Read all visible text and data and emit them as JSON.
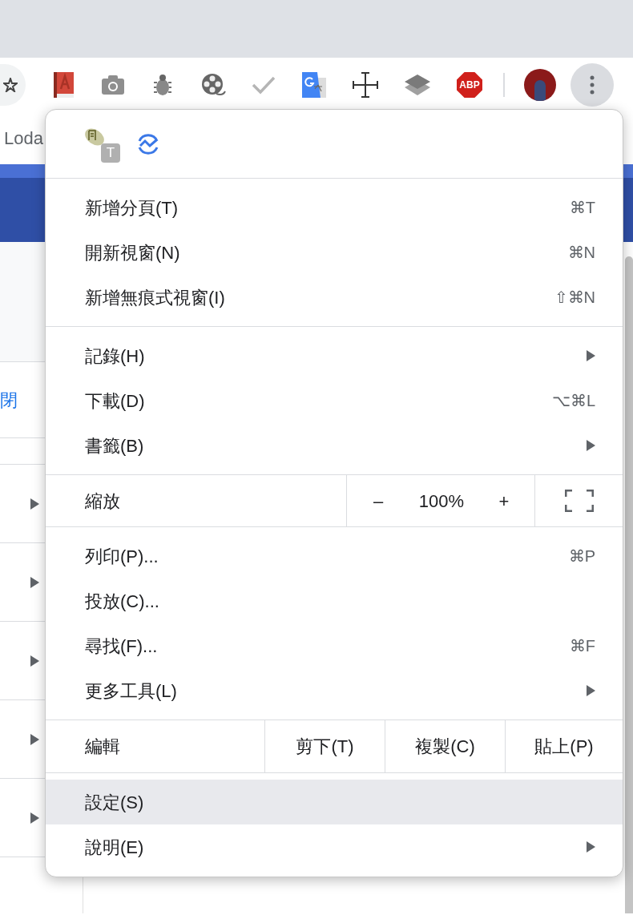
{
  "toolbar": {
    "extensions": [
      {
        "kind": "book"
      },
      {
        "kind": "camera"
      },
      {
        "kind": "bug"
      },
      {
        "kind": "film"
      },
      {
        "kind": "check"
      },
      {
        "kind": "translate"
      },
      {
        "kind": "crosshair"
      },
      {
        "kind": "layers"
      },
      {
        "kind": "abp",
        "label": "ABP"
      }
    ]
  },
  "bookmarks_bar": {
    "item": "Loda"
  },
  "page": {
    "link": "閉",
    "rows": [
      {
        "arrow": true
      },
      {
        "arrow": true
      },
      {
        "arrow": true
      },
      {
        "arrow": true
      },
      {
        "arrow": true
      }
    ]
  },
  "menu": {
    "header_icons": [
      {
        "kind": "dict",
        "badge": "T"
      },
      {
        "kind": "wave"
      }
    ],
    "sections": [
      {
        "kind": "items",
        "items": [
          {
            "label": "新增分頁(T)",
            "shortcut": "⌘T",
            "submenu": false,
            "highlighted": false
          },
          {
            "label": "開新視窗(N)",
            "shortcut": "⌘N",
            "submenu": false,
            "highlighted": false
          },
          {
            "label": "新增無痕式視窗(I)",
            "shortcut": "⇧⌘N",
            "submenu": false,
            "highlighted": false
          }
        ]
      },
      {
        "kind": "items",
        "items": [
          {
            "label": "記錄(H)",
            "submenu": true,
            "highlighted": false
          },
          {
            "label": "下載(D)",
            "shortcut": "⌥⌘L",
            "submenu": false,
            "highlighted": false
          },
          {
            "label": "書籤(B)",
            "submenu": true,
            "highlighted": false
          }
        ]
      },
      {
        "kind": "zoom",
        "label": "縮放",
        "minus": "–",
        "value": "100%",
        "plus": "+"
      },
      {
        "kind": "items",
        "items": [
          {
            "label": "列印(P)...",
            "shortcut": "⌘P",
            "submenu": false,
            "highlighted": false
          },
          {
            "label": "投放(C)...",
            "submenu": false,
            "highlighted": false
          },
          {
            "label": "尋找(F)...",
            "shortcut": "⌘F",
            "submenu": false,
            "highlighted": false
          },
          {
            "label": "更多工具(L)",
            "submenu": true,
            "highlighted": false
          }
        ]
      },
      {
        "kind": "edit",
        "label": "編輯",
        "buttons": [
          "剪下(T)",
          "複製(C)",
          "貼上(P)"
        ]
      },
      {
        "kind": "items",
        "items": [
          {
            "label": "設定(S)",
            "submenu": false,
            "highlighted": true
          },
          {
            "label": "說明(E)",
            "submenu": true,
            "highlighted": false
          }
        ]
      }
    ]
  }
}
